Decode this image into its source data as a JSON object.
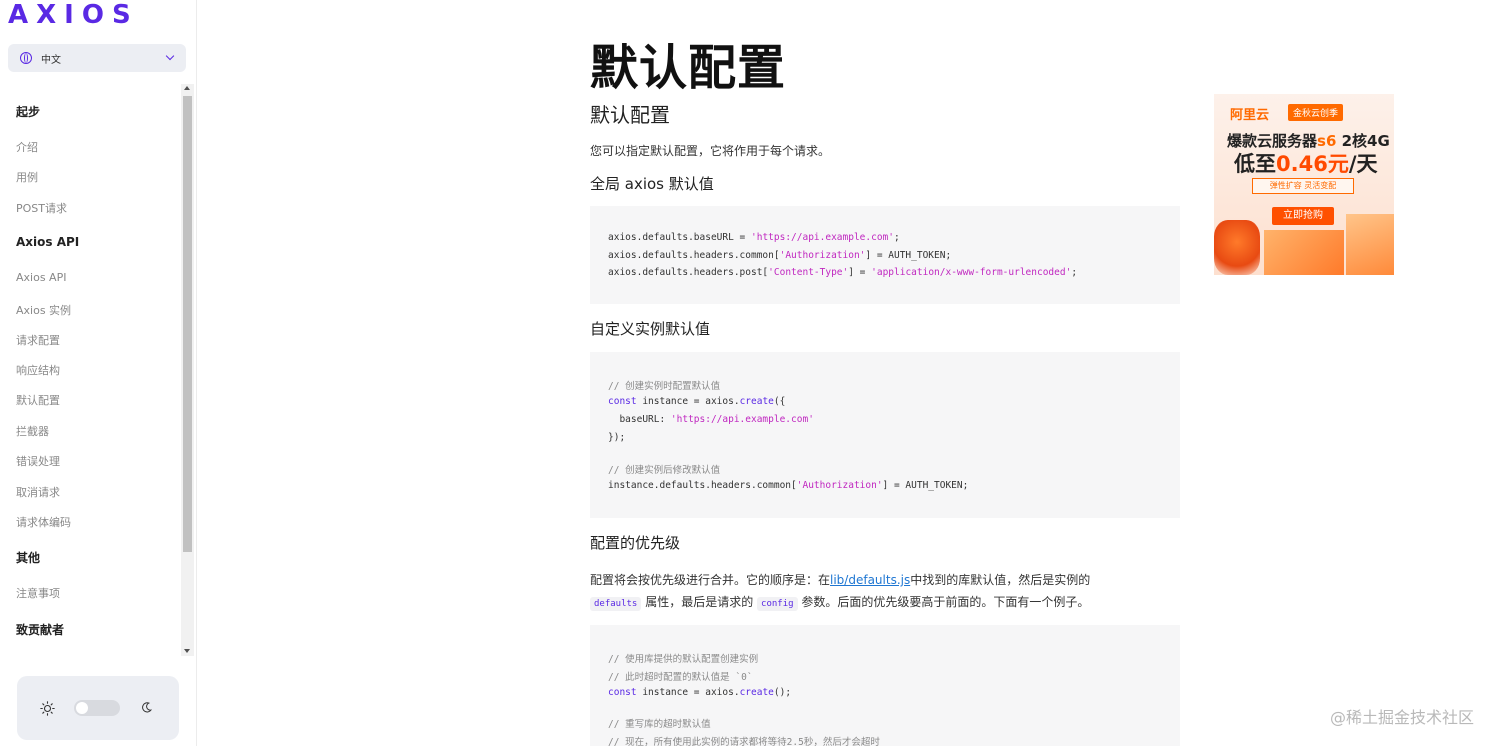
{
  "app": {
    "logo": "AXIOS",
    "language": "中文"
  },
  "sidebar": {
    "sections": [
      {
        "title": "起步",
        "items": [
          "介绍",
          "用例",
          "POST请求"
        ]
      },
      {
        "title": "Axios API",
        "items": [
          "Axios API",
          "Axios 实例",
          "请求配置",
          "响应结构",
          "默认配置",
          "拦截器",
          "错误处理",
          "取消请求",
          "请求体编码"
        ]
      },
      {
        "title": "其他",
        "items": [
          "注意事项"
        ]
      },
      {
        "title": "致贡献者",
        "items": []
      }
    ]
  },
  "content": {
    "page_title": "默认配置",
    "subtitle": "默认配置",
    "intro": "您可以指定默认配置，它将作用于每个请求。",
    "global_heading": "全局 axios 默认值",
    "global_code": [
      "axios.defaults.baseURL = 'https://api.example.com';",
      "axios.defaults.headers.common['Authorization'] = AUTH_TOKEN;",
      "axios.defaults.headers.post['Content-Type'] = 'application/x-www-form-urlencoded';"
    ],
    "instance_heading": "自定义实例默认值",
    "instance_code": {
      "c1": "// 创建实例时配置默认值",
      "l2a": "const",
      "l2b": " instance = axios.",
      "l2c": "create",
      "l2d": "({",
      "l3a": "  baseURL: ",
      "l3b": "'https://api.example.com'",
      "l4": "});",
      "c2": "// 创建实例后修改默认值",
      "l6a": "instance.defaults.headers.common[",
      "l6b": "'Authorization'",
      "l6c": "] = AUTH_TOKEN;"
    },
    "priority_heading": "配置的优先级",
    "priority_para": {
      "p1": "配置将会按优先级进行合并。它的顺序是：在",
      "link": "lib/defaults.js",
      "p2": "中找到的库默认值，然后是实例的",
      "code1": "defaults",
      "p3": "属性，最后是请求的",
      "code2": "config",
      "p4": "参数。后面的优先级要高于前面的。下面有一个例子。"
    },
    "priority_code": {
      "c1": "// 使用库提供的默认配置创建实例",
      "c2": "// 此时超时配置的默认值是 `0`",
      "l3a": "const",
      "l3b": " instance = axios.",
      "l3c": "create",
      "l3d": "();",
      "c3": "// 重写库的超时默认值",
      "c4": "// 现在，所有使用此实例的请求都将等待2.5秒，然后才会超时"
    }
  },
  "ad": {
    "brand": "阿里云",
    "badge": "金秋云创季",
    "line1_a": "爆款云服务器",
    "line1_b": "s6",
    "line1_c": " 2核4G",
    "line2_a": "低至",
    "line2_b": "0.46元",
    "line2_c": "/天",
    "tag": "弹性扩容 灵活变配",
    "button": "立即抢购"
  },
  "watermark": "@稀土掘金技术社区",
  "colors": {
    "accent": "#5a29e4",
    "string": "#c028c0",
    "link": "#1e76d2",
    "ad_orange": "#ff6a00"
  }
}
